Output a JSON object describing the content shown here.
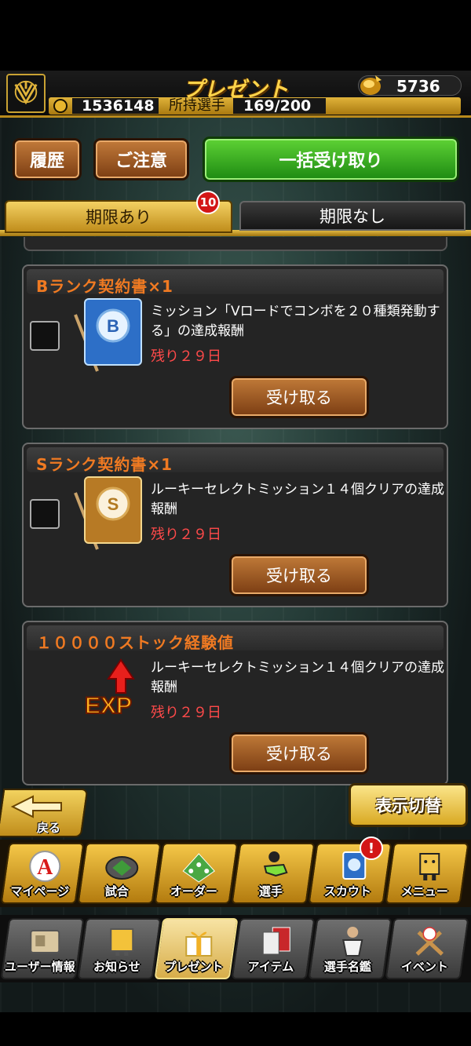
{
  "header": {
    "title": "プレゼント",
    "gold": "5736",
    "coins": "1536148",
    "players_label": "所持選手",
    "players_value": "169/200"
  },
  "actions": {
    "history": "履歴",
    "notice": "ご注意",
    "receive_all": "一括受け取り"
  },
  "tabs": {
    "limited": "期限あり",
    "unlimited": "期限なし",
    "badge": "10"
  },
  "items": [
    {
      "title": "Bランク契約書×1",
      "description": "ミッション「Vロードでコンボを２０種類発動する」の達成報酬",
      "remaining": "残り２９日",
      "button": "受け取る",
      "icon": "b-rank-contract-icon"
    },
    {
      "title": "Sランク契約書×1",
      "description": "ルーキーセレクトミッション１４個クリアの達成報酬",
      "remaining": "残り２９日",
      "button": "受け取る",
      "icon": "s-rank-contract-icon"
    },
    {
      "title": "１００００ストック経験値",
      "description": "ルーキーセレクトミッション１４個クリアの達成報酬",
      "remaining": "残り２９日",
      "button": "受け取る",
      "icon": "exp-icon"
    }
  ],
  "footer": {
    "back": "戻る",
    "toggle_view": "表示切替"
  },
  "nav_primary": [
    {
      "label": "マイページ",
      "icon": "mypage-icon"
    },
    {
      "label": "試合",
      "icon": "stadium-icon"
    },
    {
      "label": "オーダー",
      "icon": "order-field-icon"
    },
    {
      "label": "選手",
      "icon": "player-icon"
    },
    {
      "label": "スカウト",
      "icon": "scout-icon"
    },
    {
      "label": "メニュー",
      "icon": "menu-icon"
    }
  ],
  "nav_secondary": [
    {
      "label": "ユーザー情報",
      "icon": "user-info-icon"
    },
    {
      "label": "お知らせ",
      "icon": "notice-icon"
    },
    {
      "label": "プレゼント",
      "icon": "present-icon"
    },
    {
      "label": "アイテム",
      "icon": "item-icon"
    },
    {
      "label": "選手名鑑",
      "icon": "player-directory-icon"
    },
    {
      "label": "イベント",
      "icon": "event-icon"
    }
  ],
  "scout_alert": "!",
  "colors": {
    "accent_gold": "#e0b33a",
    "title_orange": "#f07a22",
    "remain_red": "#ff4a4a",
    "receive_all_green": "#2f9e1f"
  }
}
